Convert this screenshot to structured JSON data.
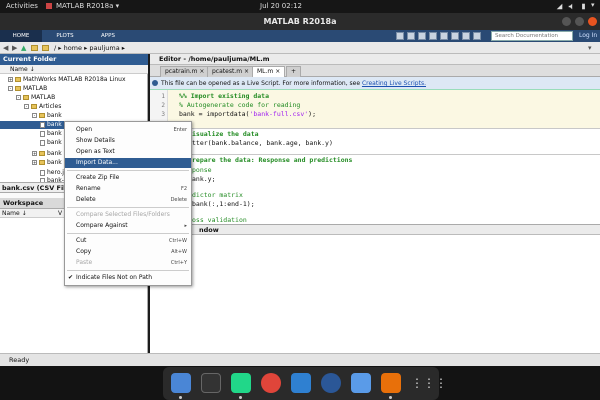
{
  "topbar": {
    "activities": "Activities",
    "app_menu": "MATLAB R2018a ▾",
    "clock": "Jul 20  02:12"
  },
  "window": {
    "title": "MATLAB R2018a"
  },
  "toolstrip": {
    "tabs": [
      "HOME",
      "PLOTS",
      "APPS"
    ],
    "search_placeholder": "Search Documentation",
    "login": "Log In"
  },
  "address": {
    "path": "/ ▸ home ▸ pauljuma ▸"
  },
  "current_folder": {
    "title": "Current Folder",
    "column": "Name ↓",
    "rows": [
      "MathWorks MATLAB R2018a Linux",
      "MATLAB",
      "MATLAB",
      "Articles",
      "bank",
      "bank",
      "bank",
      "bank",
      "bank",
      "bank",
      "hero.j",
      "bank-"
    ],
    "details_title": "bank.csv  (CSV File)"
  },
  "workspace": {
    "title": "Workspace",
    "col_name": "Name ↓",
    "col_value": "V"
  },
  "editor": {
    "title": "Editor - /home/pauljuma/ML.m",
    "tabs": [
      "pcatrain.m",
      "pcatest.m",
      "ML.m"
    ],
    "info_text": "This file can be opened as a Live Script. For more information, see",
    "info_link": "Creating Live Scripts.",
    "line_numbers": [
      "1",
      "2",
      "3"
    ],
    "code_lines": [
      "%% Import existing data",
      "% Autogenerate code for reading",
      "bank = importdata('bank-full.csv');",
      "isualize the data",
      "tter(bank.balance, bank.age, bank.y)",
      "repare the data: Response and predictions",
      "ponse",
      "ank.y;",
      "dictor matrix",
      "bank(:,1:end-1);",
      "oss validation"
    ]
  },
  "command_window": {
    "title": "ndow",
    "prompt": "fx"
  },
  "status": {
    "text": "Ready"
  },
  "context_menu": {
    "items": [
      {
        "label": "Open",
        "shortcut": "Enter"
      },
      {
        "label": "Show Details",
        "shortcut": ""
      },
      {
        "label": "Open as Text",
        "shortcut": ""
      },
      {
        "label": "Import Data...",
        "shortcut": ""
      },
      {
        "label": "Create Zip File",
        "shortcut": ""
      },
      {
        "label": "Rename",
        "shortcut": "F2"
      },
      {
        "label": "Delete",
        "shortcut": "Delete"
      },
      {
        "label": "Compare Selected Files/Folders",
        "shortcut": ""
      },
      {
        "label": "Compare Against",
        "shortcut": "▸"
      },
      {
        "label": "Cut",
        "shortcut": "Ctrl+W"
      },
      {
        "label": "Copy",
        "shortcut": "Alt+W"
      },
      {
        "label": "Paste",
        "shortcut": "Ctrl+Y"
      },
      {
        "label": "Indicate Files Not on Path",
        "shortcut": ""
      }
    ]
  },
  "colors": {
    "accent": "#2f5c92",
    "toolstrip": "#2a4a74",
    "ubuntu_close": "#e95420"
  },
  "dock": {
    "apps": [
      "finder-icon",
      "terminal-icon",
      "pycharm-icon",
      "chrome-icon",
      "vscode-icon",
      "word-icon",
      "kolourpaint-icon",
      "matlab-icon",
      "app-grid-icon"
    ]
  }
}
